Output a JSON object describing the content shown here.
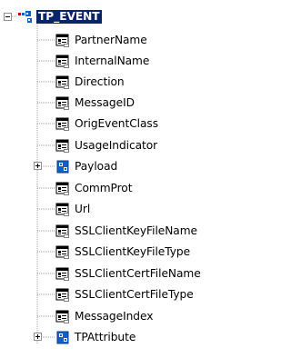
{
  "tree": {
    "root": {
      "label": "TP_EVENT",
      "expanded": true
    },
    "children": [
      {
        "label": "PartnerName",
        "icon": "property-icon"
      },
      {
        "label": "InternalName",
        "icon": "property-icon"
      },
      {
        "label": "Direction",
        "icon": "property-icon"
      },
      {
        "label": "MessageID",
        "icon": "property-icon"
      },
      {
        "label": "OrigEventClass",
        "icon": "property-icon"
      },
      {
        "label": "UsageIndicator",
        "icon": "property-icon"
      },
      {
        "label": "Payload",
        "icon": "class-icon",
        "expandable": true
      },
      {
        "label": "CommProt",
        "icon": "property-icon"
      },
      {
        "label": "Url",
        "icon": "property-icon"
      },
      {
        "label": "SSLClientKeyFileName",
        "icon": "property-icon"
      },
      {
        "label": "SSLClientKeyFileType",
        "icon": "property-icon"
      },
      {
        "label": "SSLClientCertFileName",
        "icon": "property-icon"
      },
      {
        "label": "SSLClientCertFileType",
        "icon": "property-icon"
      },
      {
        "label": "MessageIndex",
        "icon": "property-icon"
      },
      {
        "label": "TPAttribute",
        "icon": "class-icon",
        "expandable": true
      }
    ]
  },
  "colors": {
    "selection": "#0a246a",
    "guide_line": "#a0a0a0",
    "class_icon_blue": "#1060c8"
  }
}
